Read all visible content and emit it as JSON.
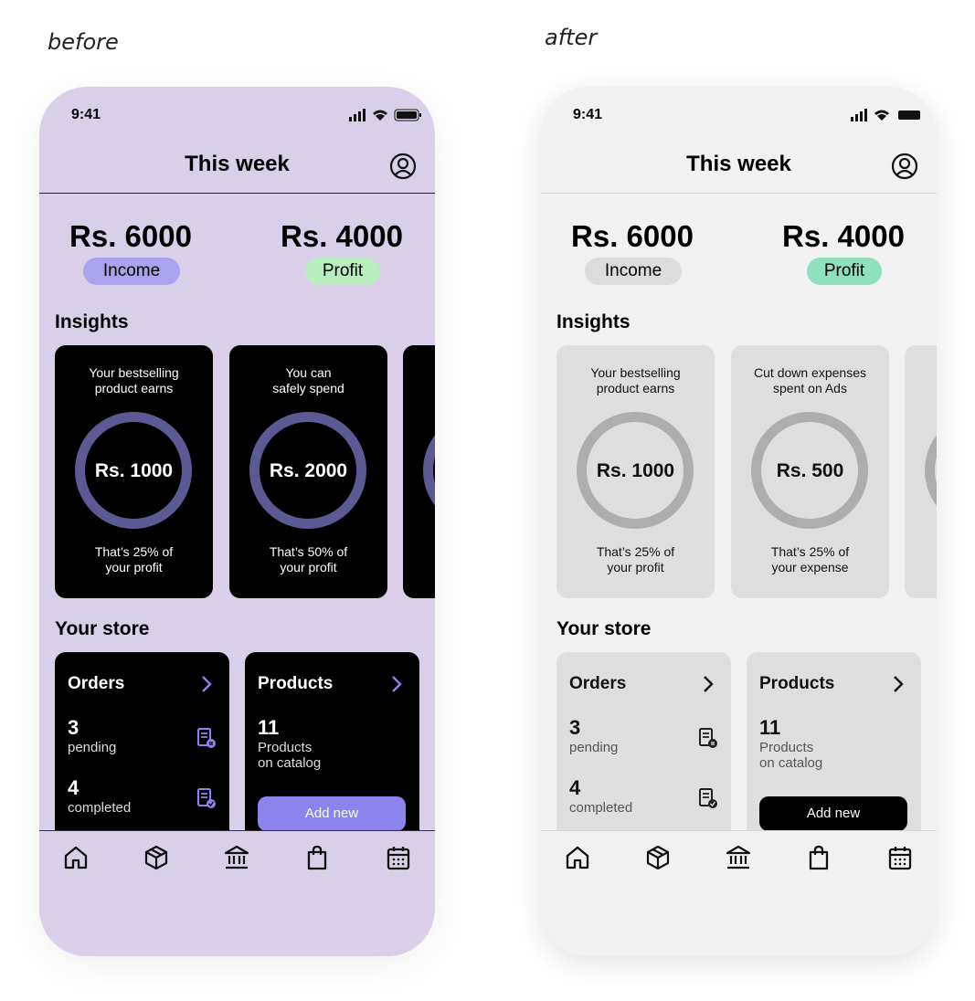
{
  "captions": {
    "before": "before",
    "after": "after"
  },
  "phones": {
    "before": {
      "status_time": "9:41",
      "header_title": "This week",
      "income_amount": "Rs. 6000",
      "income_label": "Income",
      "profit_amount": "Rs. 4000",
      "profit_label": "Profit",
      "insights_title": "Insights",
      "insights": [
        {
          "top": "Your bestselling\nproduct earns",
          "value": "Rs. 1000",
          "bottom": "That’s 25% of\nyour profit"
        },
        {
          "top": "You can\nsafely spend",
          "value": "Rs. 2000",
          "bottom": "That’s 50% of\nyour profit"
        }
      ],
      "store_title": "Your store",
      "orders": {
        "title": "Orders",
        "pending_count": "3",
        "pending_label": "pending",
        "completed_count": "4",
        "completed_label": "completed"
      },
      "products": {
        "title": "Products",
        "count": "11",
        "label": "Products\non catalog",
        "add_label": "Add new"
      }
    },
    "after": {
      "status_time": "9:41",
      "header_title": "This week",
      "income_amount": "Rs. 6000",
      "income_label": "Income",
      "profit_amount": "Rs. 4000",
      "profit_label": "Profit",
      "insights_title": "Insights",
      "insights": [
        {
          "top": "Your bestselling\nproduct earns",
          "value": "Rs. 1000",
          "bottom": "That’s 25% of\nyour profit"
        },
        {
          "top": "Cut down expenses\nspent on Ads",
          "value": "Rs. 500",
          "bottom": "That’s 25% of\nyour expense"
        }
      ],
      "store_title": "Your store",
      "orders": {
        "title": "Orders",
        "pending_count": "3",
        "pending_label": "pending",
        "completed_count": "4",
        "completed_label": "completed"
      },
      "products": {
        "title": "Products",
        "count": "11",
        "label": "Products\non catalog",
        "add_label": "Add new"
      }
    }
  },
  "icons": {
    "profile": "user-circle-icon",
    "chevron": "chevron-right-icon",
    "pending_doc": "document-pending-icon",
    "completed_doc": "document-check-icon",
    "tabs": [
      "home-icon",
      "box-icon",
      "bank-icon",
      "shopping-bag-icon",
      "calendar-icon"
    ]
  },
  "colors": {
    "before_background": "#d9cfe8",
    "after_background": "#f1f1f1",
    "before_accent": "#8c84ec",
    "before_ring": "#5c5a94",
    "after_ring": "#adadad",
    "profit_before": "#b8edbe",
    "profit_after": "#8ee0be"
  }
}
